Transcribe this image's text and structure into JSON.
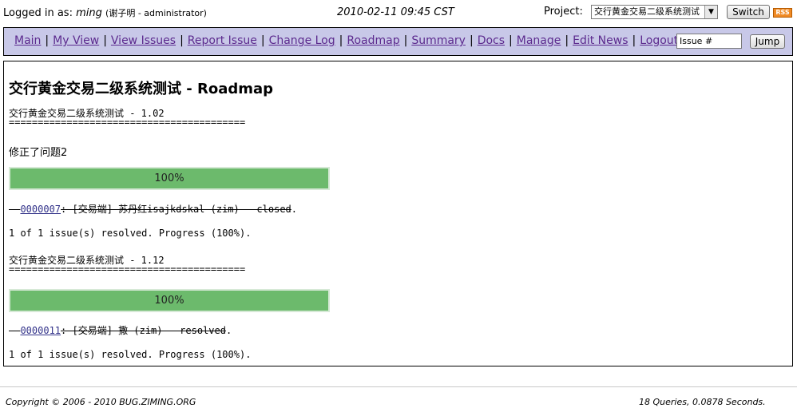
{
  "header": {
    "login_label": "Logged in as:",
    "username": "ming",
    "user_meta": "(谢子明 - administrator)",
    "datetime": "2010-02-11 09:45 CST",
    "project_label": "Project:",
    "project_selected": "交行黄金交易二级系统测试",
    "switch_label": "Switch",
    "rss_label": "RSS"
  },
  "menu": {
    "items": [
      "Main",
      "My View",
      "View Issues",
      "Report Issue",
      "Change Log",
      "Roadmap",
      "Summary",
      "Docs",
      "Manage",
      "Edit News",
      "Logout"
    ],
    "issue_input_value": "Issue #",
    "jump_label": "Jump"
  },
  "content": {
    "title": "交行黄金交易二级系统测试 - Roadmap",
    "versions": [
      {
        "heading": "交行黄金交易二级系统测试 - 1.02",
        "underline": "=========================================",
        "description": "修正了问题2",
        "progress_percent": 100,
        "progress_label": "100%",
        "issue": {
          "prefix": "- ",
          "id": "0000007",
          "summary": ": [交易端] 苏丹红isajkdskal (zim) - closed",
          "suffix": "."
        },
        "status": "1 of 1 issue(s) resolved. Progress (100%)."
      },
      {
        "heading": "交行黄金交易二级系统测试 - 1.12",
        "underline": "=========================================",
        "progress_percent": 100,
        "progress_label": "100%",
        "issue": {
          "prefix": "- ",
          "id": "0000011",
          "summary": ": [交易端] 撒 (zim) - resolved",
          "suffix": "."
        },
        "status": "1 of 1 issue(s) resolved. Progress (100%)."
      }
    ]
  },
  "footer": {
    "copyright": "Copyright © 2006 - 2010 BUG.ZIMING.ORG",
    "queries": "18 Queries, 0.0878 Seconds."
  },
  "colors": {
    "menu_bg": "#c8c8e8",
    "link": "#5c2a8e",
    "progress_fill": "#6cba6c"
  }
}
